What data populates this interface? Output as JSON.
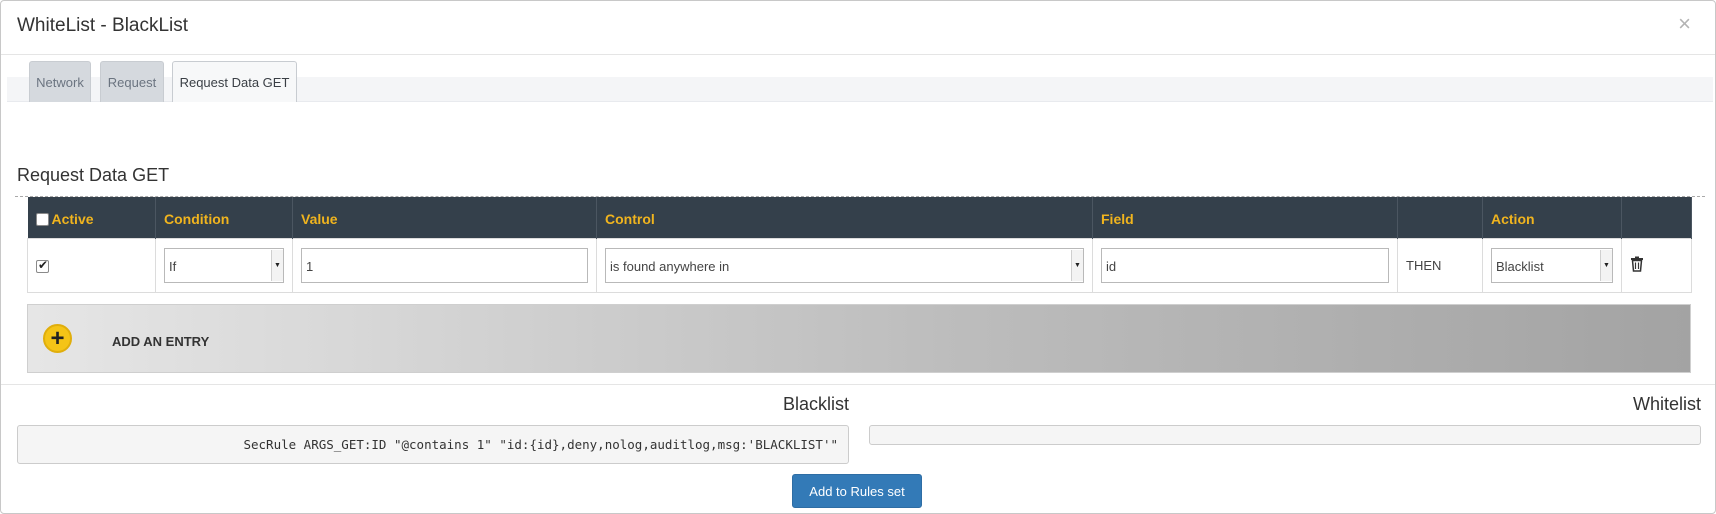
{
  "dialog": {
    "title": "WhiteList - BlackList",
    "close_glyph": "×"
  },
  "tabs": [
    {
      "label": "Network",
      "active": false
    },
    {
      "label": "Request",
      "active": false
    },
    {
      "label": "Request Data GET",
      "active": true
    }
  ],
  "section": {
    "title": "Request Data GET"
  },
  "table": {
    "headers": {
      "active": "Active",
      "condition": "Condition",
      "value": "Value",
      "control": "Control",
      "field": "Field",
      "then": "",
      "action": "Action",
      "delete": ""
    },
    "rows": [
      {
        "active_checked": true,
        "condition": "If",
        "value": "1",
        "control": "is found anywhere in",
        "field": "id",
        "then": "THEN",
        "action": "Blacklist",
        "delete_icon": "trash-icon"
      }
    ]
  },
  "add_entry": {
    "label": "ADD AN ENTRY",
    "icon": "plus-icon",
    "icon_glyph": "+",
    "icon_color": "#f4c417"
  },
  "output": {
    "blacklist_label": "Blacklist",
    "blacklist_rule": "SecRule ARGS_GET:ID \"@contains 1\" \"id:{id},deny,nolog,auditlog,msg:'BLACKLIST'\"",
    "whitelist_label": "Whitelist",
    "whitelist_rule": ""
  },
  "actions": {
    "add_to_rules_label": "Add to Rules set"
  },
  "colors": {
    "header_bg": "#34404b",
    "header_text": "#f0b41e",
    "primary_button": "#337ab7"
  }
}
